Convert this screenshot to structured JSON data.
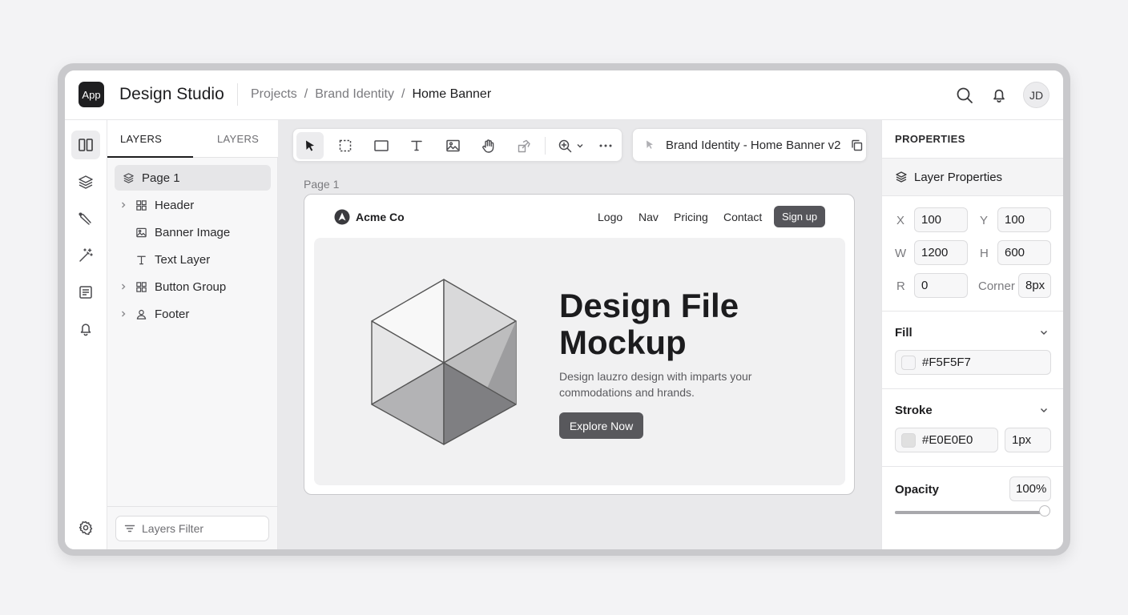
{
  "app": {
    "badge": "App",
    "title": "Design Studio"
  },
  "breadcrumb": {
    "items": [
      "Projects",
      "Brand Identity",
      "Home Banner"
    ],
    "separator": "/"
  },
  "header": {
    "avatar_initials": "JD",
    "icons": [
      "search-icon",
      "bell-icon"
    ]
  },
  "rail": {
    "icons": [
      "panels-icon",
      "layers-icon",
      "pen-tool-icon",
      "magic-wand-icon",
      "document-icon",
      "bell-icon",
      "settings-icon"
    ]
  },
  "layers_panel": {
    "tabs": [
      "LAYERS",
      "LAYERS"
    ],
    "items": [
      {
        "label": "Page 1",
        "icon": "layers-icon",
        "selected": true,
        "expandable": false
      },
      {
        "label": "Header",
        "icon": "grid-icon",
        "selected": false,
        "expandable": true
      },
      {
        "label": "Banner Image",
        "icon": "image-icon",
        "selected": false,
        "expandable": false
      },
      {
        "label": "Text Layer",
        "icon": "text-icon",
        "selected": false,
        "expandable": false
      },
      {
        "label": "Button Group",
        "icon": "grid-icon",
        "selected": false,
        "expandable": true
      },
      {
        "label": "Footer",
        "icon": "user-icon",
        "selected": false,
        "expandable": true
      }
    ],
    "filter_placeholder": "Layers Filter"
  },
  "toolbar": {
    "tools": [
      "cursor-icon",
      "marquee-icon",
      "rectangle-icon",
      "text-icon",
      "image-icon",
      "hand-icon",
      "transform-icon",
      "zoom-icon",
      "more-icon"
    ],
    "document_name": "Brand Identity - Home Banner v2"
  },
  "canvas": {
    "page_label": "Page 1",
    "mock": {
      "brand": "Acme Co",
      "nav": [
        "Logo",
        "Nav",
        "Pricing",
        "Contact"
      ],
      "signup": "Sign up",
      "hero_title_line1": "Design File",
      "hero_title_line2": "Mockup",
      "hero_sub_line1": "Design lauzro design with imparts your",
      "hero_sub_line2": "commodations and hrands.",
      "cta": "Explore Now"
    }
  },
  "properties": {
    "heading": "PROPERTIES",
    "section": "Layer Properties",
    "fields": {
      "x_label": "X",
      "x": "100",
      "y_label": "Y",
      "y": "100",
      "w_label": "W",
      "w": "1200",
      "h_label": "H",
      "h": "600",
      "r_label": "R",
      "r": "0",
      "corner_label": "Corner",
      "corner": "8px"
    },
    "fill": {
      "title": "Fill",
      "value": "#F5F5F7",
      "swatch": "#F5F5F7"
    },
    "stroke": {
      "title": "Stroke",
      "value": "#E0E0E0",
      "width": "1px",
      "swatch": "#E0E0E0"
    },
    "opacity": {
      "title": "Opacity",
      "value": "100%",
      "level": 1.0
    }
  }
}
